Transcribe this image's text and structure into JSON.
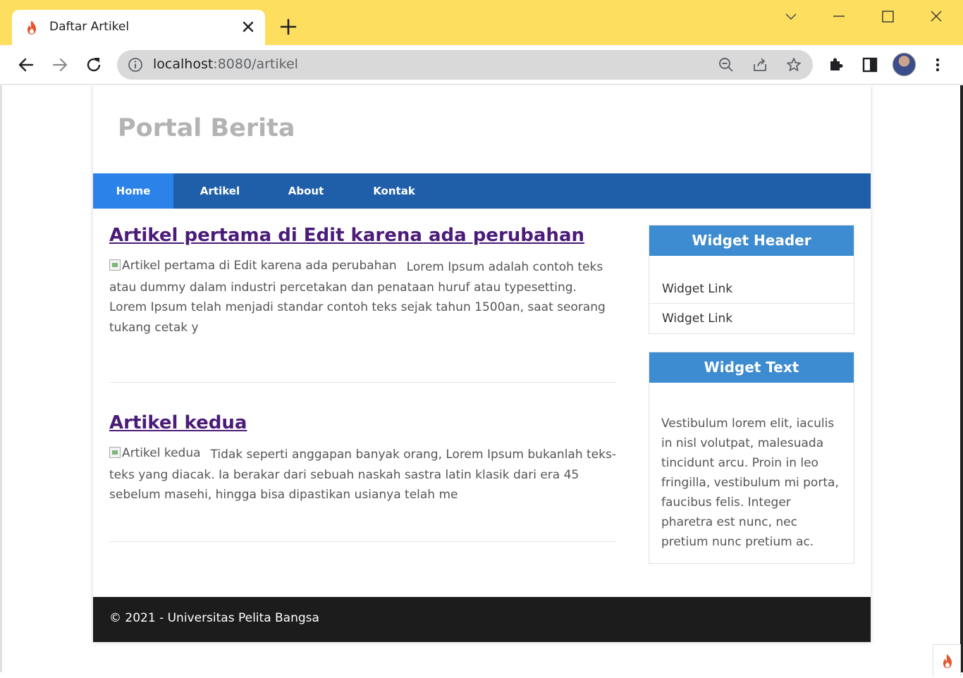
{
  "browser": {
    "tab_title": "Daftar Artikel",
    "url_host": "localhost",
    "url_rest": ":8080/artikel",
    "colors": {
      "tabbar": "#fede5e",
      "omnibox": "#d9d9d9"
    }
  },
  "site": {
    "title": "Portal Berita",
    "nav": [
      {
        "label": "Home",
        "active": true
      },
      {
        "label": "Artikel",
        "active": false
      },
      {
        "label": "About",
        "active": false
      },
      {
        "label": "Kontak",
        "active": false
      }
    ],
    "articles": [
      {
        "title": "Artikel pertama di Edit karena ada perubahan",
        "image_alt": "Artikel pertama di Edit karena ada perubahan",
        "excerpt": "Lorem Ipsum adalah contoh teks atau dummy dalam industri percetakan dan penataan huruf atau typesetting. Lorem Ipsum telah menjadi standar contoh teks sejak tahun 1500an, saat seorang tukang cetak y"
      },
      {
        "title": "Artikel kedua",
        "image_alt": "Artikel kedua",
        "excerpt": "Tidak seperti anggapan banyak orang, Lorem Ipsum bukanlah teks-teks yang diacak. Ia berakar dari sebuah naskah sastra latin klasik dari era 45 sebelum masehi, hingga bisa dipastikan usianya telah me"
      }
    ],
    "sidebar": {
      "widget_header": {
        "title": "Widget Header",
        "links": [
          "Widget Link",
          "Widget Link"
        ]
      },
      "widget_text": {
        "title": "Widget Text",
        "body": "Vestibulum lorem elit, iaculis in nisl volutpat, malesuada tincidunt arcu. Proin in leo fringilla, vestibulum mi porta, faucibus felis. Integer pharetra est nunc, nec pretium nunc pretium ac."
      }
    },
    "footer": "© 2021 - Universitas Pelita Bangsa",
    "colors": {
      "nav": "#1f5faa",
      "nav_active": "#2b83ea",
      "widget_header": "#3d8bd0",
      "article_link": "#4b1b79",
      "footer": "#1c1c1c",
      "site_title": "#b3b3b3"
    }
  }
}
